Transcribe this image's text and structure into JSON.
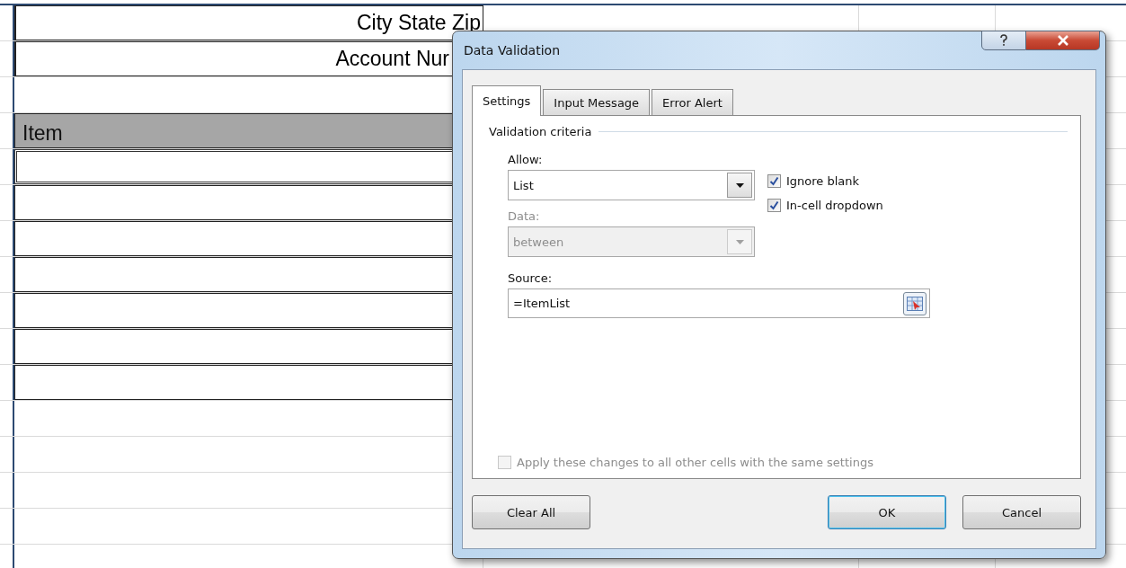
{
  "sheet": {
    "rows": [
      {
        "kind": "label",
        "text": "City State Zip"
      },
      {
        "kind": "label",
        "text": "Account Nur"
      },
      {
        "kind": "blank"
      },
      {
        "kind": "header",
        "text": "Item"
      },
      {
        "kind": "entry",
        "selected": true
      },
      {
        "kind": "entry",
        "selected": false
      },
      {
        "kind": "entry",
        "selected": false
      },
      {
        "kind": "entry",
        "selected": false
      },
      {
        "kind": "entry",
        "selected": false
      },
      {
        "kind": "entry",
        "selected": false
      },
      {
        "kind": "entry",
        "selected": false
      },
      {
        "kind": "blank"
      },
      {
        "kind": "blank"
      },
      {
        "kind": "blank"
      },
      {
        "kind": "blank"
      },
      {
        "kind": "blank"
      }
    ]
  },
  "dialog": {
    "title": "Data Validation",
    "tabs": [
      {
        "label": "Settings",
        "selected": true
      },
      {
        "label": "Input Message",
        "selected": false
      },
      {
        "label": "Error Alert",
        "selected": false
      }
    ],
    "section": "Validation criteria",
    "allow": {
      "label": "Allow:",
      "value": "List",
      "disabled": false
    },
    "options": [
      {
        "label": "Ignore blank",
        "checked": true
      },
      {
        "label": "In-cell dropdown",
        "checked": true
      }
    ],
    "data": {
      "label": "Data:",
      "value": "between",
      "disabled": true
    },
    "source": {
      "label": "Source:",
      "value": "=ItemList"
    },
    "apply": {
      "label": "Apply these changes to all other cells with the same settings",
      "checked": false,
      "disabled": true
    },
    "buttons": [
      {
        "label": "Clear All",
        "kind": "normal"
      },
      {
        "label": "OK",
        "kind": "default"
      },
      {
        "label": "Cancel",
        "kind": "normal"
      }
    ]
  }
}
